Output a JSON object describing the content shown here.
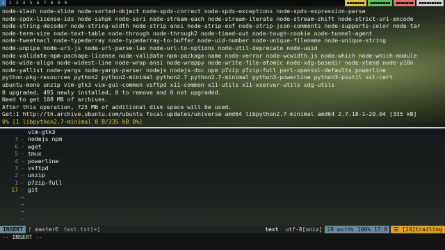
{
  "topbar": {
    "workspaces": [
      "1",
      "2",
      "3",
      "4",
      "5",
      "6",
      "7",
      "8",
      "9",
      "0"
    ],
    "active_index": 0,
    "right_items": [
      {
        "label": "◼◼◼◼◼◼◼",
        "color": "#e0c040"
      },
      {
        "label": "◼◼◼◼◼◼◼◼",
        "color": "#60c060"
      },
      {
        "label": "◼◼◼◼◼◼◼",
        "color": "#e07070"
      },
      {
        "label": "◼◼◼◼◼◼◼◼◼",
        "color": "#d0d0d0"
      }
    ]
  },
  "terminal": {
    "lines": [
      "node-slash node-slide node-sorted-object node-spdx-correct node-spdx-exceptions node-spdx-expression-parse",
      "node-spdx-license-ids node-sshpk node-ssri node-stream-each node-stream-iterate node-stream-shift node-strict-uri-encode",
      "node-string-decoder node-string-width node-strip-ansi node-strip-eof node-strip-json-comments node-supports-color node-tar",
      "node-term-size node-text-table node-through node-through2 node-timed-out node-tough-cookie node-tunnel-agent",
      "node-tweetnacl node-typedarray node-typedarray-to-buffer node-uid-number node-unique-filename node-unique-string",
      "node-unpipe node-uri-js node-url-parse-lax node-url-to-options node-util-deprecate node-uuid",
      "node-validate-npm-package-license node-validate-npm-package-name node-verror node-wcwidth.js node-which node-which-module",
      "node-wide-align node-widest-line node-wrap-ansi node-wrappy node-write-file-atomic node-xdg-basedir node-xtend node-y18n",
      "node-yallist node-yargs node-yargs-parser nodejs nodejs-doc npm p7zip p7zip-full perl-openssl-defaults powerline",
      "python-pkg-resources python2 python2-minimal python2.7 python2.7-minimal python3-powerline python3-psutil ssl-cert",
      "ubuntu-mono unzip vim-gtk3 vim-gui-common vsftpd x11-common x11-utils x11-xserver-utils xdg-utils",
      "0 upgraded, 495 newly installed, 0 to remove and 0 not upgraded.",
      "Need to get 108 MB of archives.",
      "After this operation, 725 MB of additional disk space will be used.",
      "Get:1 http://th.archive.ubuntu.com/ubuntu focal-updates/universe amd64 libpython2.7-minimal amd64 2.7.18-1~20.04 [335 kB]",
      "0% [1 libpython2.7-minimal 0 B/335 kB 0%]"
    ]
  },
  "vim": {
    "lines": [
      {
        "num": "",
        "sign": "",
        "text": "vim-gtk3"
      },
      {
        "num": "7",
        "sign": "-",
        "text": "nodejs npm"
      },
      {
        "num": "6",
        "sign": "-",
        "text": "wget"
      },
      {
        "num": "5",
        "sign": "-",
        "text": "tmux"
      },
      {
        "num": "4",
        "sign": "-",
        "text": "powerline"
      },
      {
        "num": "3",
        "sign": "-",
        "text": "vsftpd"
      },
      {
        "num": "2",
        "sign": "-",
        "text": "unzip"
      },
      {
        "num": "1",
        "sign": "-",
        "text": "p7zip-full"
      },
      {
        "num": "17",
        "sign": "-",
        "text": "git"
      },
      {
        "num": "",
        "sign": "~",
        "text": ""
      },
      {
        "num": "",
        "sign": "~",
        "text": ""
      },
      {
        "num": "",
        "sign": "~",
        "text": ""
      },
      {
        "num": "",
        "sign": "~",
        "text": ""
      }
    ],
    "current_line_index": 8
  },
  "statusline": {
    "mode": "INSERT",
    "branch": "ᚠ masterE",
    "filename": "test.txt[+]",
    "filetype": "text",
    "encoding": "utf-8[unix]",
    "words": "28 words",
    "percent": "100%",
    "position": "17:8",
    "trailing": "☰ [14]trailing"
  },
  "cmdline": "-- INSERT --"
}
